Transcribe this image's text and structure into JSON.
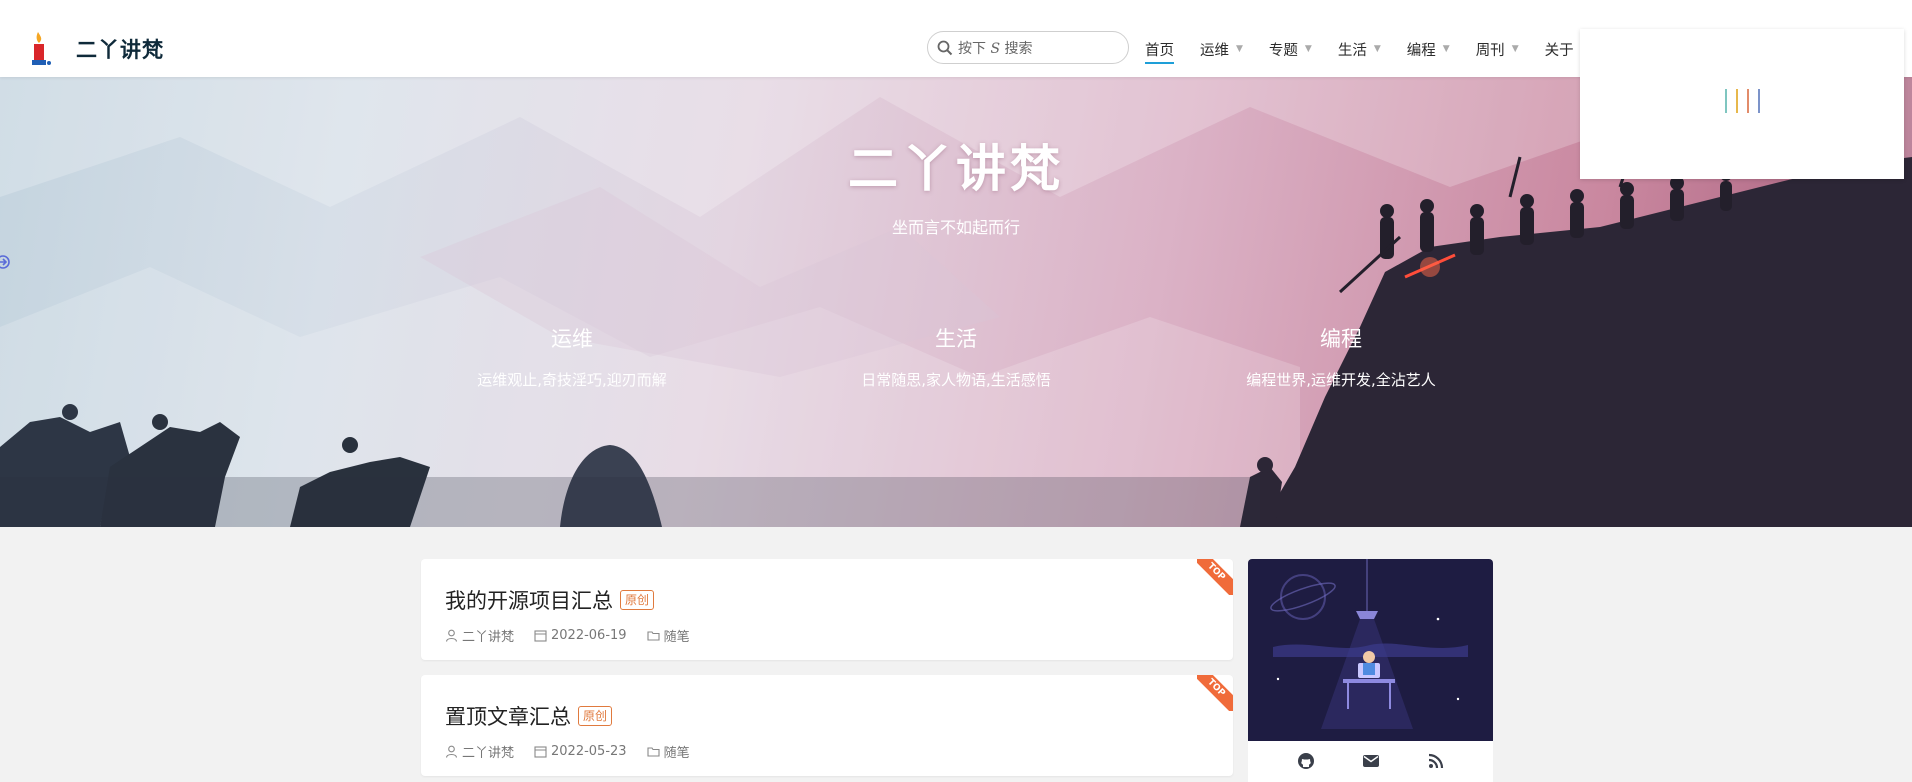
{
  "header": {
    "site_name": "二丫讲梵",
    "search_placeholder_prefix": "按下",
    "search_shortcut": "S",
    "search_placeholder_suffix": "搜索",
    "nav": [
      {
        "label": "首页",
        "has_dropdown": false,
        "active": true
      },
      {
        "label": "运维",
        "has_dropdown": true,
        "active": false
      },
      {
        "label": "专题",
        "has_dropdown": true,
        "active": false
      },
      {
        "label": "生活",
        "has_dropdown": true,
        "active": false
      },
      {
        "label": "编程",
        "has_dropdown": true,
        "active": false
      },
      {
        "label": "周刊",
        "has_dropdown": true,
        "active": false
      },
      {
        "label": "关于",
        "has_dropdown": false,
        "active": false
      }
    ]
  },
  "loading": {
    "bar_colors": [
      "#7fc6c0",
      "#e7b84c",
      "#e28c6a",
      "#7c93c9"
    ]
  },
  "banner": {
    "title": "二丫讲梵",
    "subtitle": "坐而言不如起而行",
    "categories": [
      {
        "name": "运维",
        "desc": "运维观止,奇技淫巧,迎刃而解"
      },
      {
        "name": "生活",
        "desc": "日常随思,家人物语,生活感悟"
      },
      {
        "name": "编程",
        "desc": "编程世界,运维开发,全沾艺人"
      }
    ]
  },
  "posts": [
    {
      "title": "我的开源项目汇总",
      "badge": "原创",
      "author": "二丫讲梵",
      "date": "2022-06-19",
      "category": "随笔",
      "ribbon": "TOP"
    },
    {
      "title": "置顶文章汇总",
      "badge": "原创",
      "author": "二丫讲梵",
      "date": "2022-05-23",
      "category": "随笔",
      "ribbon": "TOP"
    }
  ],
  "profile": {
    "socials": [
      "github-icon",
      "mail-icon",
      "rss-icon"
    ]
  },
  "colors": {
    "accent": "#1e9fd8",
    "badge": "#e07a3e",
    "ribbon": "#f06b3a"
  }
}
